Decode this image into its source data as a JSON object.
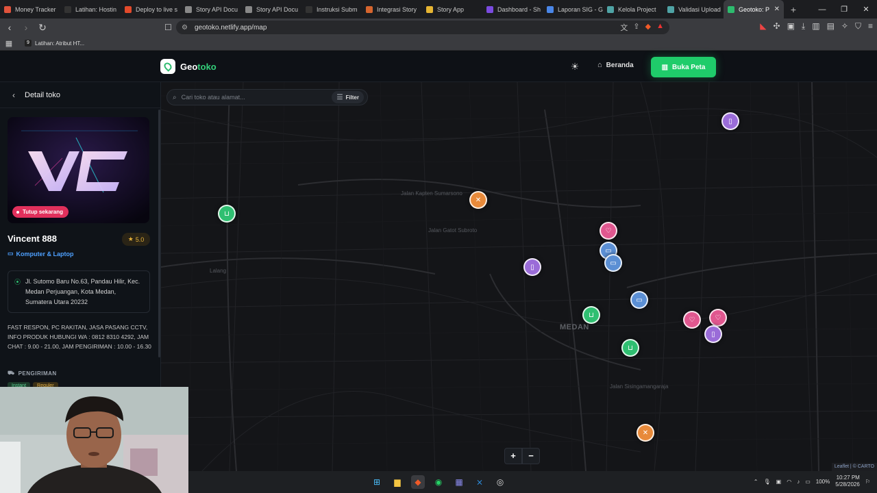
{
  "browser": {
    "tabs": [
      {
        "title": "Money Tracker",
        "color": "#e0533c"
      },
      {
        "title": "Latihan: Hostin",
        "color": "#333333"
      },
      {
        "title": "Deploy to live s",
        "color": "#e24a2b"
      },
      {
        "title": "Story API Docu",
        "color": "#888888"
      },
      {
        "title": "Story API Docu",
        "color": "#888888"
      },
      {
        "title": "Instruksi Subm",
        "color": "#333333"
      },
      {
        "title": "Integrasi Story",
        "color": "#d6652e"
      },
      {
        "title": "Story App",
        "color": "#e6b533"
      },
      {
        "title": "Dashboard - Sh",
        "color": "#7b4be0"
      },
      {
        "title": "Laporan SIG - G",
        "color": "#4a86e8"
      },
      {
        "title": "Kelola Project",
        "color": "#4fa3a5"
      },
      {
        "title": "Validasi Upload",
        "color": "#4fa3a5"
      },
      {
        "title": "Geotoko: P",
        "color": "#2dbb6e",
        "active": true
      }
    ],
    "url": "geotoko.netlify.app/map",
    "bookmark": "Latihan: Atribut HT..."
  },
  "header": {
    "logo_prefix": "Geo",
    "logo_accent": "toko",
    "home_label": "Beranda",
    "map_button_label": "Buka Peta"
  },
  "sidebar": {
    "title": "Detail toko",
    "status_badge": "Tutup sekarang",
    "store_name": "Vincent 888",
    "rating": "5.0",
    "category": "Komputer & Laptop",
    "address": "Jl. Sutomo Baru No.63, Pandau Hilir, Kec. Medan Perjuangan, Kota Medan, Sumatera Utara 20232",
    "description": "FAST RESPON, PC RAKITAN, JASA PASANG CCTV, INFO PRODUK HUBUNGI WA : 0812 8310 4292, JAM CHAT : 9.00 - 21.00, JAM PENGIRIMAN : 10.00 - 16.30",
    "delivery_title": "PENGIRIMAN",
    "delivery_chips": [
      "Instant",
      "Reguler"
    ]
  },
  "map": {
    "search_placeholder": "Cari toko atau alamat...",
    "filter_label": "Filter",
    "city_label": "MEDAN",
    "labels": [
      "Lalang",
      "Jalan Kapten Sumarsono",
      "Jalan Gatot Subroto",
      "Jalan Sisingamangaraja"
    ],
    "attribution_leaflet": "Leaflet",
    "attribution_carto": "© CARTO"
  },
  "taskbar": {
    "battery": "100%",
    "time": "10:27 PM",
    "date": "5/28/2026"
  }
}
